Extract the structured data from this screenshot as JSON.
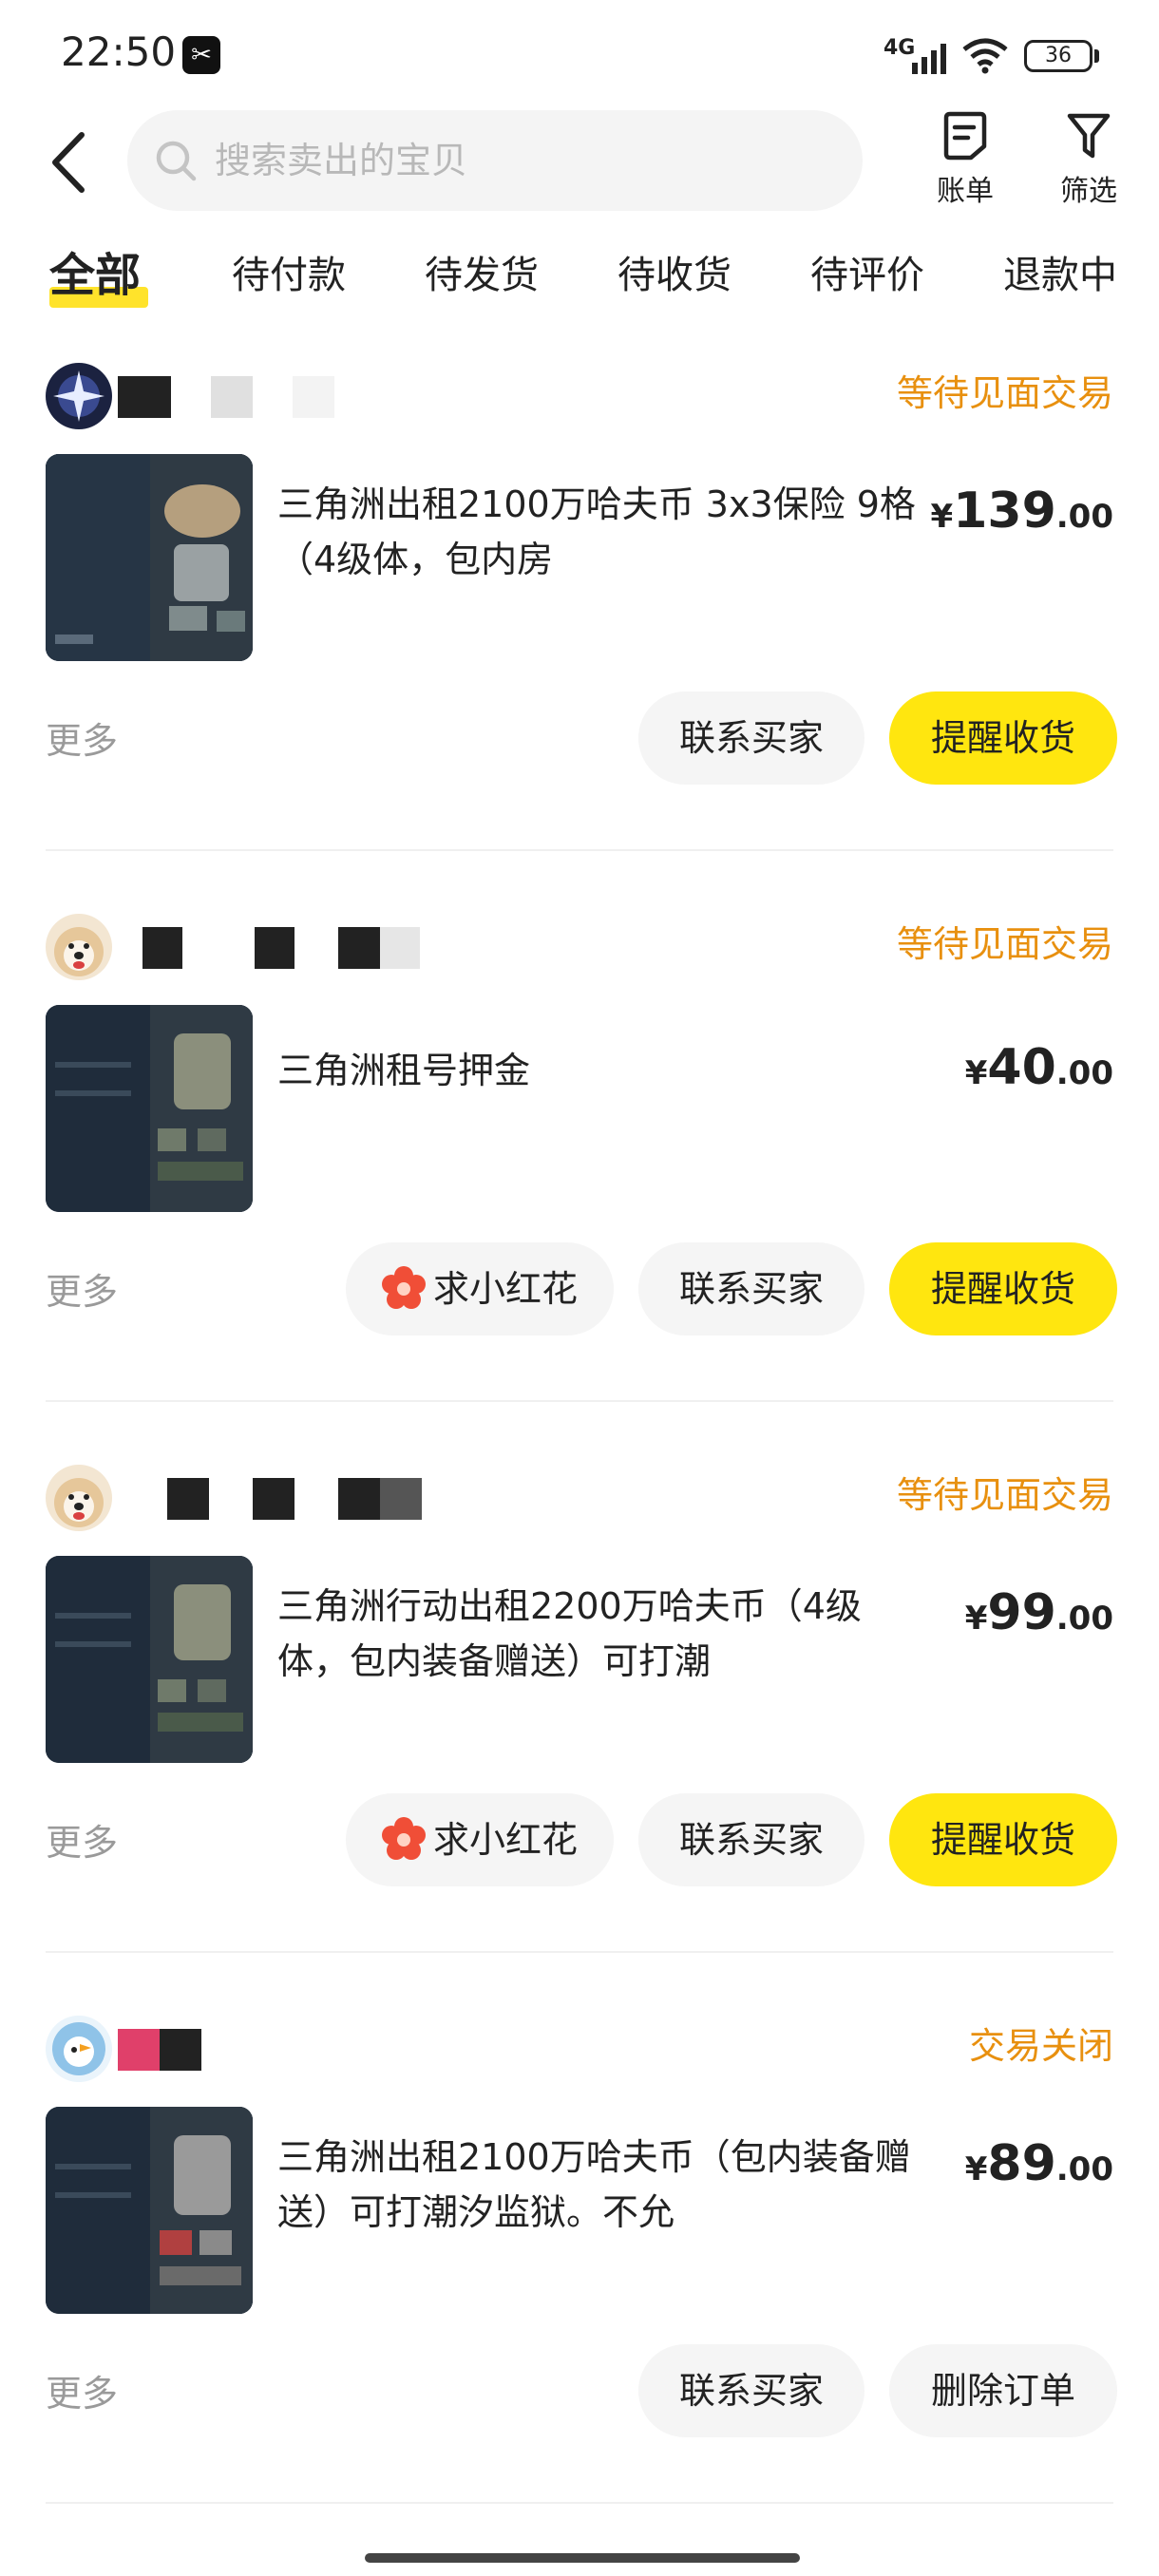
{
  "status_bar": {
    "time": "22:50",
    "network": "4G",
    "battery": "36"
  },
  "header": {
    "search_placeholder": "搜索卖出的宝贝",
    "bill_label": "账单",
    "filter_label": "筛选"
  },
  "tabs": [
    "全部",
    "待付款",
    "待发货",
    "待收货",
    "待评价",
    "退款中"
  ],
  "orders": [
    {
      "status": "等待见面交易",
      "title": "三角洲出租2100万哈夫币 3x3保险 9格（4级体，包内房",
      "price_currency": "¥",
      "price_int": "139",
      "price_dec": ".00",
      "more": "更多",
      "buttons": [
        "联系买家",
        "提醒收货"
      ]
    },
    {
      "status": "等待见面交易",
      "title": "三角洲租号押金",
      "price_currency": "¥",
      "price_int": "40",
      "price_dec": ".00",
      "more": "更多",
      "buttons": [
        "求小红花",
        "联系买家",
        "提醒收货"
      ]
    },
    {
      "status": "等待见面交易",
      "title": "三角洲行动出租2200万哈夫币（4级体，包内装备赠送）可打潮",
      "price_currency": "¥",
      "price_int": "99",
      "price_dec": ".00",
      "more": "更多",
      "buttons": [
        "求小红花",
        "联系买家",
        "提醒收货"
      ]
    },
    {
      "status": "交易关闭",
      "title": "三角洲出租2100万哈夫币（包内装备赠送）可打潮汐监狱。不允",
      "price_currency": "¥",
      "price_int": "89",
      "price_dec": ".00",
      "more": "更多",
      "buttons": [
        "联系买家",
        "删除订单"
      ]
    }
  ],
  "colors": {
    "accent_yellow": "#ffe60f",
    "status_orange": "#e8900f"
  }
}
